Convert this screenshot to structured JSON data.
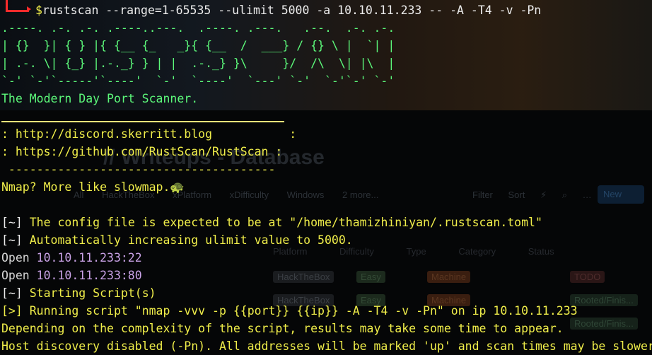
{
  "terminal": {
    "command": {
      "dollar": "$",
      "text": "rustscan --range=1-65535 --ulimit 5000 -a 10.10.11.233 -- -A -T4 -v -Pn"
    },
    "banner": [
      ".----. .-. .-. .----..---.  .----. .---.   .--.  .-. .-.",
      "| {}  }| { } |{ {__ {_   _}{ {__  /  ___} / {} \\ |  `| |",
      "| .-. \\| {_} |.-._} } | |  .-._} }\\     }/  /\\  \\| |\\  |",
      "`-' `-'`-----'`----'  `-'  `----'  `---' `-'  `-'`-' `-'"
    ],
    "tagline": "The Modern Day Port Scanner.",
    "discord_line": ": http://discord.skerritt.blog           :",
    "github_line": ": https://github.com/RustScan/RustScan :",
    "dash_line": " --------------------------------------",
    "nmap_joke": "Nmap? More like slowmap.🐢",
    "output": [
      {
        "prefix": "[~]",
        "text": " The config file is expected to be at \"/home/thamizhiniyan/.rustscan.toml\""
      },
      {
        "prefix": "[~]",
        "text": " Automatically increasing ulimit value to 5000."
      }
    ],
    "open_ports": [
      {
        "label": "Open ",
        "addr": "10.10.11.233:22"
      },
      {
        "label": "Open ",
        "addr": "10.10.11.233:80"
      }
    ],
    "script_lines": [
      {
        "prefix": "[~]",
        "text": " Starting Script(s)"
      },
      {
        "prefix": "[>]",
        "text": " Running script \"nmap -vvv -p {{port}} {{ip}} -A -T4 -v -Pn\" on ip 10.10.11.233"
      }
    ],
    "tail": [
      "Depending on the complexity of the script, results may take some time to appear.",
      "Host discovery disabled (-Pn). All addresses will be marked 'up' and scan times may be slower."
    ]
  },
  "background_page": {
    "title": "// Writeups - Database",
    "tabs": [
      "All",
      "HackTheBox",
      "xPlatform",
      "xDifficulty",
      "Windows",
      "2 more..."
    ],
    "actions": [
      "Filter",
      "Sort",
      "⚡",
      "⌕",
      "…"
    ],
    "new_button": "New",
    "columns": [
      "Platform",
      "Difficulty",
      "Type",
      "Category",
      "Status"
    ],
    "rows": [
      {
        "platform": "HackTheBox",
        "difficulty": "Easy",
        "type": "Machine",
        "status": "TODO"
      },
      {
        "platform": "HackTheBox",
        "difficulty": "Easy",
        "type": "Machine",
        "status": "Rooted/Finis..."
      },
      {
        "platform": "",
        "difficulty": "",
        "type": "",
        "status": "Rooted/Finis..."
      }
    ]
  },
  "colors": {
    "prompt_red": "#ff2b2b",
    "banner_green": "#5cf87a",
    "link_yellow": "#f0ee4a",
    "ip_purple": "#c9a2e6",
    "background": "#050607"
  }
}
